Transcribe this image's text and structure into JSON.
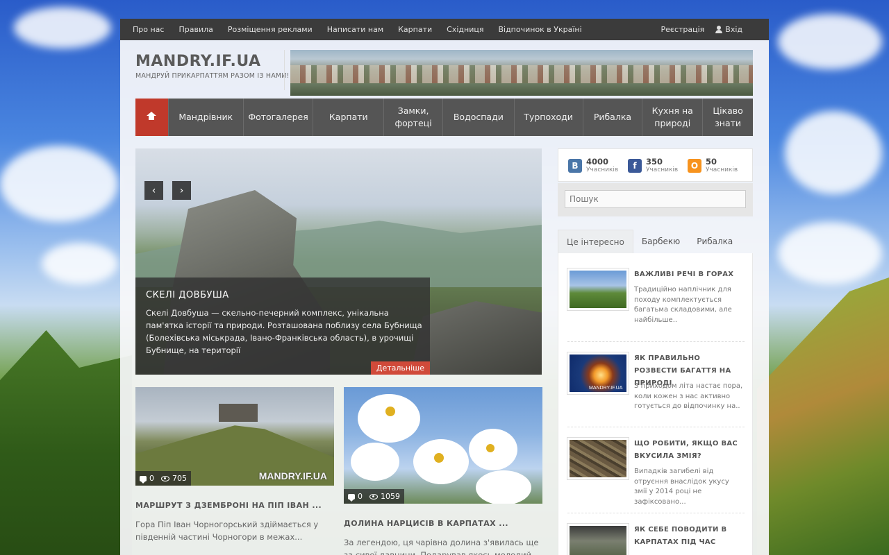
{
  "topnav": {
    "links": [
      "Про нас",
      "Правила",
      "Розміщення реклами",
      "Написати нам",
      "Карпати",
      "Східниця",
      "Відпочинок в Україні"
    ],
    "register": "Реєстрація",
    "login": "Вхід"
  },
  "header": {
    "site_name": "MANDRY.IF.UA",
    "tagline": "МАНДРУЙ ПРИКАРПАТТЯМ РАЗОМ ІЗ НАМИ!"
  },
  "mainnav": {
    "items": [
      "Мандрівник",
      "Фотогалерея",
      "Карпати",
      "Замки, фортеці",
      "Водоспади",
      "Турпоходи",
      "Рибалка",
      "Кухня на природі",
      "Цікаво знати"
    ]
  },
  "slider": {
    "prev": "‹",
    "next": "›",
    "title": "СКЕЛІ ДОВБУША",
    "text": "Скелі Довбуша — скельно-печерний комплекс, унікальна пам'ятка історії та природи. Розташована поблизу села Бубнища (Болехівська міськрада, Івано-Франківська область), в урочищі Бубнище, на території",
    "more": "Детальніше"
  },
  "posts": [
    {
      "title": "МАРШРУТ З ДЗЕМБРОНІ НА ПІП ІВАН ...",
      "excerpt": "Гора Піп Іван Чорногорський здіймається у південній частині Чорногори в межах...",
      "comments": "0",
      "views": "705",
      "watermark": "MANDRY.IF.UA"
    },
    {
      "title": "ДОЛИНА НАРЦИСІВ В КАРПАТАХ ...",
      "excerpt": "За легендою, ця чарівна долина з'явилась ще за сивої давнини. Подарував якось молодий",
      "comments": "0",
      "views": "1059"
    }
  ],
  "social": [
    {
      "icon": "В",
      "count": "4000",
      "label": "Учасників",
      "color": "#4a76a8"
    },
    {
      "icon": "f",
      "count": "350",
      "label": "Учасників",
      "color": "#3b5998"
    },
    {
      "icon": "О",
      "count": "50",
      "label": "Учасників",
      "color": "#f7931e"
    }
  ],
  "search": {
    "placeholder": "Пошук"
  },
  "sidebar": {
    "tabs": [
      "Це інтересно",
      "Барбекю",
      "Рибалка"
    ],
    "items": [
      {
        "title": "ВАЖЛИВІ РЕЧІ В ГОРАХ",
        "excerpt": "Традиційно наплічник для походу комплектується багатьма складовими, але найбільше.."
      },
      {
        "title": "ЯК ПРАВИЛЬНО РОЗВЕСТИ БАГАТТЯ НА ПРИРОДІ",
        "excerpt": "З приходом літа настає пора, коли кожен з нас активно готується до відпочинку на..",
        "watermark": "MANDRY.IF.UA"
      },
      {
        "title": "ЩО РОБИТИ, ЯКЩО ВАС ВКУСИЛА ЗМІЯ?",
        "excerpt": "Випадків загибелі від отруєння внаслідок укусу змії у 2014 році не зафіксовано..."
      },
      {
        "title": "ЯК СЕБЕ ПОВОДИТИ В КАРПАТАХ ПІД ЧАС",
        "excerpt": ""
      }
    ]
  }
}
